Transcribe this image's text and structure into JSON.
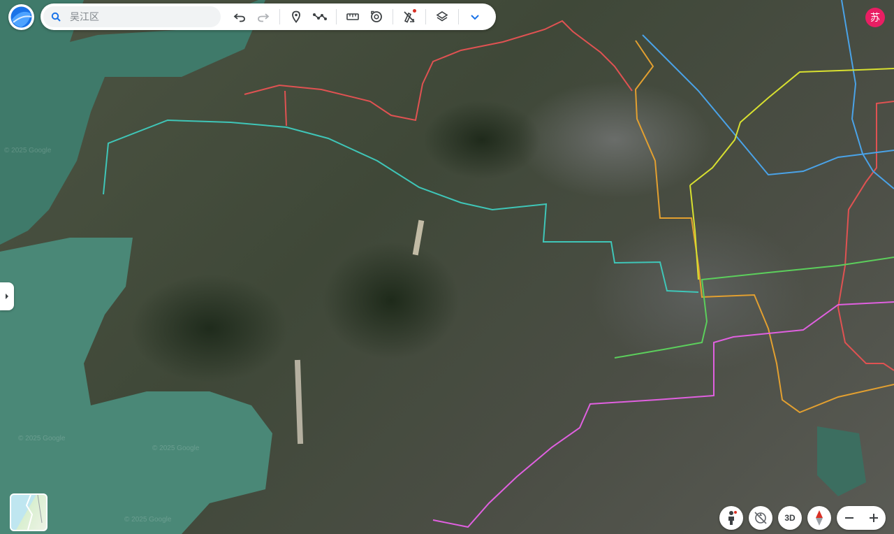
{
  "search": {
    "value": "",
    "placeholder": "吴江区"
  },
  "toolbar": {
    "search_icon": "search-icon",
    "tools": [
      "undo-icon",
      "redo-icon",
      "placemark-icon",
      "path-icon",
      "measure-icon",
      "history-icon",
      "clear-icon",
      "layers-icon",
      "chevron-down-icon"
    ]
  },
  "account": {
    "avatar_text": "苏"
  },
  "controls": {
    "pegman": "pegman-icon",
    "tilt_reset": "tilt-reset-icon",
    "view_3d": "3D",
    "compass": "compass-icon",
    "zoom_out": "−",
    "zoom_in": "+"
  },
  "map": {
    "watermarks": [
      "© 2025 Google",
      "© 2025 Google",
      "© 2025 Google",
      "© 2025 Google"
    ],
    "route_colors": [
      "#e05252",
      "#3fc6b8",
      "#e3a030",
      "#4aa3e8",
      "#d8e030",
      "#5ccf5c",
      "#e060e0"
    ]
  }
}
